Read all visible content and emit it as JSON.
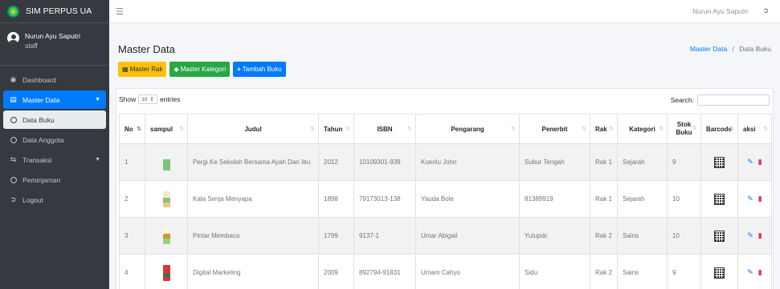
{
  "app": {
    "brand": "SIM PERPUS UA"
  },
  "user": {
    "name": "Nurun Ayu Saputri",
    "role": "staff"
  },
  "sidebar": {
    "items": [
      {
        "label": "Dashboard"
      },
      {
        "label": "Master Data"
      },
      {
        "label": "Data Buku"
      },
      {
        "label": "Data Anggota"
      },
      {
        "label": "Transaksi"
      },
      {
        "label": "Peminjaman"
      },
      {
        "label": "Logout"
      }
    ]
  },
  "topbar": {
    "user_name": "Nurun Ayu Saputri"
  },
  "page": {
    "title": "Master Data",
    "breadcrumb": {
      "link": "Master Data",
      "separator": "/",
      "current": "Data Buku"
    }
  },
  "buttons": {
    "master_rak": "Master Rak",
    "master_kategori": "Master Kategori",
    "tambah_buku": "Tambah Buku"
  },
  "table_controls": {
    "show_label": "Show",
    "length_value": "10",
    "entries_label": "entries",
    "search_label": "Search:"
  },
  "columns": {
    "no": "No",
    "sampul": "sampul",
    "judul": "Judul",
    "tahun": "Tahun",
    "isbn": "ISBN",
    "pengarang": "Pengarang",
    "penerbit": "Penerbit",
    "rak": "Rak",
    "kategori": "Kategori",
    "stok_1": "Stok",
    "stok_2": "Buku",
    "barcode": "Barcode",
    "aksi": "aksi"
  },
  "rows": [
    {
      "no": "1",
      "judul": "Pergi Ke Sekolah Bersama Ayah Dan Ibu",
      "tahun": "2012",
      "isbn": "10109301-939",
      "pengarang": "Koenlu John",
      "penerbit": "Subur Tengah",
      "rak": "Rak 1",
      "kategori": "Sejarah",
      "stok": "9",
      "cover_color": "#7cc576"
    },
    {
      "no": "2",
      "judul": "Kala Senja Menyapa",
      "tahun": "1898",
      "isbn": "79173013-138",
      "pengarang": "Yauda Bole",
      "penerbit": "81389919",
      "rak": "Rak 1",
      "kategori": "Sejarah",
      "stok": "10",
      "cover_color": "#e8c98a"
    },
    {
      "no": "3",
      "judul": "Pintar Membaca",
      "tahun": "1799",
      "isbn": "9137-1",
      "pengarang": "Umar Abigail",
      "penerbit": "Yutupdc",
      "rak": "Rak 2",
      "kategori": "Sains",
      "stok": "10",
      "cover_color": "#f3e3a0"
    },
    {
      "no": "4",
      "judul": "Digital Marketing",
      "tahun": "2009",
      "isbn": "892794-91831",
      "pengarang": "Umam Cahyo",
      "penerbit": "Sidu",
      "rak": "Rak 2",
      "kategori": "Sains",
      "stok": "9",
      "cover_color": "#d9343a"
    }
  ],
  "colors": {
    "sidebar": "#343a40",
    "primary": "#007bff",
    "success": "#28a745",
    "warning": "#ffc107",
    "danger": "#dc3545"
  }
}
